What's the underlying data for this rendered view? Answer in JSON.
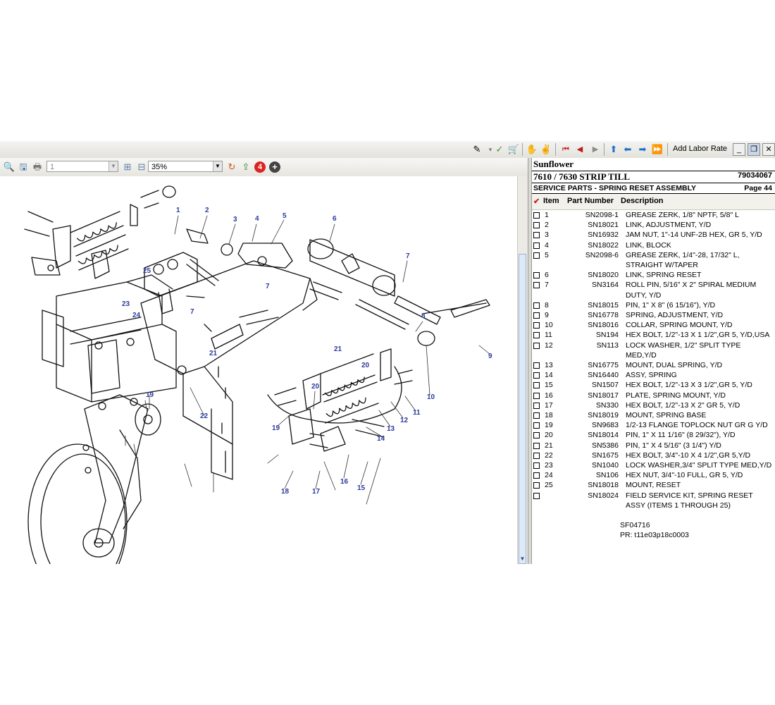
{
  "toolbar": {
    "add_labor_rate": "Add Labor Rate",
    "icons": [
      "edit-icon",
      "checkmark-icon",
      "cart-icon",
      "hands-icon",
      "first-page-icon",
      "previous-page-icon",
      "next-page-icon",
      "up-arrow-icon",
      "back-arrow-icon",
      "forward-arrow-icon",
      "double-forward-icon"
    ]
  },
  "viewer": {
    "page_number": "1",
    "zoom": "35%",
    "badge_count": "4"
  },
  "parts": {
    "brand": "Sunflower",
    "model": "7610 / 7630 STRIP TILL",
    "doc_number": "79034067",
    "section": "SERVICE PARTS - SPRING RESET ASSEMBLY",
    "page": "Page 44",
    "columns": {
      "item": "Item",
      "part": "Part Number",
      "desc": "Description"
    },
    "rows": [
      {
        "item": "1",
        "part": "SN2098-1",
        "desc": "GREASE ZERK, 1/8\" NPTF, 5/8\" L"
      },
      {
        "item": "2",
        "part": "SN18021",
        "desc": "LINK, ADJUSTMENT, Y/D"
      },
      {
        "item": "3",
        "part": "SN16932",
        "desc": "JAM NUT, 1\"-14 UNF-2B HEX, GR 5, Y/D"
      },
      {
        "item": "4",
        "part": "SN18022",
        "desc": "LINK, BLOCK"
      },
      {
        "item": "5",
        "part": "SN2098-6",
        "desc": "GREASE ZERK, 1/4\"-28, 17/32\" L, STRAIGHT W/TAPER"
      },
      {
        "item": "6",
        "part": "SN18020",
        "desc": "LINK, SPRING RESET"
      },
      {
        "item": "7",
        "part": "SN3164",
        "desc": "ROLL PIN, 5/16\" X 2\" SPIRAL MEDIUM DUTY, Y/D"
      },
      {
        "item": "8",
        "part": "SN18015",
        "desc": "PIN, 1\" X 8\" (6 15/16\"), Y/D"
      },
      {
        "item": "9",
        "part": "SN16778",
        "desc": "SPRING, ADJUSTMENT, Y/D"
      },
      {
        "item": "10",
        "part": "SN18016",
        "desc": "COLLAR, SPRING MOUNT, Y/D"
      },
      {
        "item": "11",
        "part": "SN194",
        "desc": "HEX BOLT, 1/2\"-13 X 1 1/2\",GR 5, Y/D,USA"
      },
      {
        "item": "12",
        "part": "SN113",
        "desc": "LOCK WASHER, 1/2\" SPLIT TYPE MED,Y/D"
      },
      {
        "item": "13",
        "part": "SN16775",
        "desc": "MOUNT, DUAL SPRING, Y/D"
      },
      {
        "item": "14",
        "part": "SN16440",
        "desc": "ASSY, SPRING"
      },
      {
        "item": "15",
        "part": "SN1507",
        "desc": "HEX BOLT, 1/2\"-13 X 3 1/2\",GR 5, Y/D"
      },
      {
        "item": "16",
        "part": "SN18017",
        "desc": "PLATE, SPRING MOUNT, Y/D"
      },
      {
        "item": "17",
        "part": "SN330",
        "desc": "HEX BOLT, 1/2\"-13 X 2\" GR 5, Y/D"
      },
      {
        "item": "18",
        "part": "SN18019",
        "desc": "MOUNT, SPRING BASE"
      },
      {
        "item": "19",
        "part": "SN9683",
        "desc": "1/2-13 FLANGE TOPLOCK NUT GR G Y/D"
      },
      {
        "item": "20",
        "part": "SN18014",
        "desc": "PIN, 1\" X 11 1/16\" (8 29/32\"), Y/D"
      },
      {
        "item": "21",
        "part": "SN5386",
        "desc": "PIN, 1\" X 4 5/16\" (3 1/4\") Y/D"
      },
      {
        "item": "22",
        "part": "SN1675",
        "desc": "HEX BOLT, 3/4\"-10 X 4 1/2\",GR 5,Y/D"
      },
      {
        "item": "23",
        "part": "SN1040",
        "desc": "LOCK WASHER,3/4\" SPLIT TYPE MED,Y/D"
      },
      {
        "item": "24",
        "part": "SN106",
        "desc": "HEX NUT, 3/4\"-10 FULL, GR 5, Y/D"
      },
      {
        "item": "25",
        "part": "SN18018",
        "desc": "MOUNT, RESET"
      },
      {
        "item": "",
        "part": "SN18024",
        "desc": "FIELD SERVICE KIT, SPRING RESET ASSY (ITEMS 1 THROUGH 25)"
      }
    ],
    "footnote_code": "SF04716",
    "footnote_pr": "PR: t11e03p18c0003"
  },
  "diagram": {
    "callouts": [
      "1",
      "2",
      "3",
      "4",
      "5",
      "6",
      "7",
      "7",
      "7",
      "8",
      "9",
      "10",
      "11",
      "12",
      "13",
      "14",
      "15",
      "16",
      "17",
      "18",
      "19",
      "19",
      "20",
      "20",
      "21",
      "21",
      "22",
      "23",
      "24",
      "25"
    ]
  }
}
